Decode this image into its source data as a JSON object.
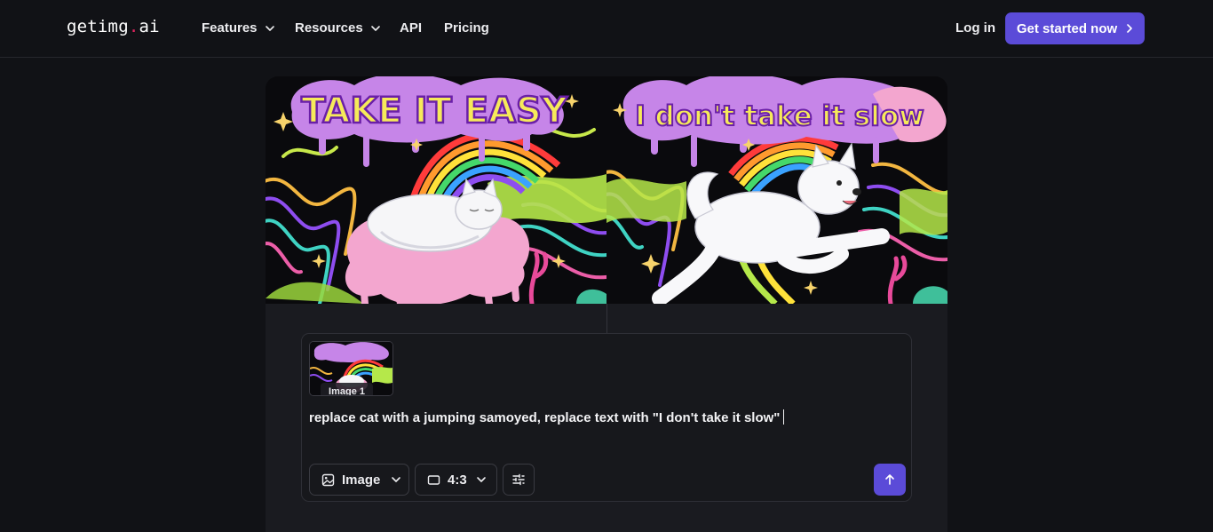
{
  "brand": {
    "name_main": "getimg",
    "name_dot": ".",
    "name_tail": "ai",
    "dot_color": "#e0245e"
  },
  "nav": {
    "items": [
      {
        "label": "Features",
        "has_dropdown": true
      },
      {
        "label": "Resources",
        "has_dropdown": true
      },
      {
        "label": "API",
        "has_dropdown": false
      },
      {
        "label": "Pricing",
        "has_dropdown": false
      }
    ],
    "login_label": "Log in",
    "cta_label": "Get started now",
    "accent": "#5b4bd8"
  },
  "gallery": {
    "left_title": "TAKE IT EASY",
    "right_title": "I don't take it slow"
  },
  "prompt_box": {
    "attachment_label": "Image 1",
    "prompt_text": "replace cat with a jumping samoyed, replace text with \"I don't take it slow\"",
    "mode_label": "Image",
    "ratio_label": "4:3"
  },
  "icons": [
    "chevron-down-icon",
    "chevron-right-icon",
    "image-icon",
    "aspect-ratio-icon",
    "sliders-icon",
    "arrow-up-icon"
  ]
}
